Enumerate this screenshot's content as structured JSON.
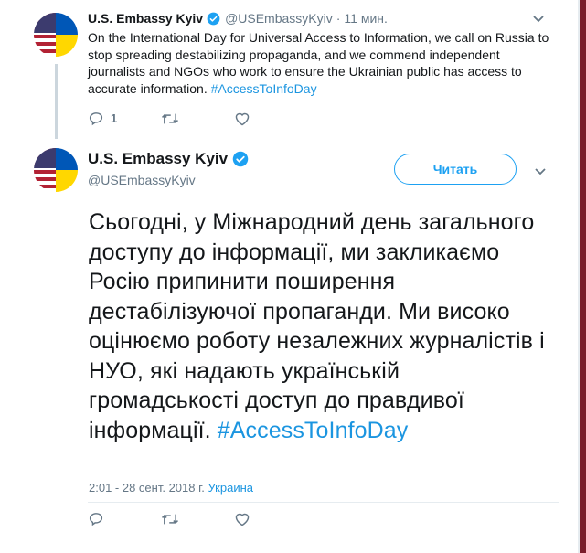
{
  "tweet1": {
    "display_name": "U.S. Embassy Kyiv",
    "handle": "@USEmbassyKyiv",
    "separator": "·",
    "time": "11 мин.",
    "text_main": "On the International Day for Universal Access to Information, we call on Russia to stop spreading destabilizing propaganda, and we commend independent journalists and NGOs who work to ensure the Ukrainian public has access to accurate information. ",
    "hashtag": "#AccessToInfoDay",
    "reply_count": "1"
  },
  "tweet2": {
    "display_name": "U.S. Embassy Kyiv",
    "handle": "@USEmbassyKyiv",
    "follow_label": "Читать",
    "text_main": "Сьогодні, у Міжнародний день загального доступу до інформації, ми закликаємо Росію припинити поширення дестабілізуючої пропаганди. Ми високо оцінюємо роботу незалежних журналістів і НУО, які надають українській громадськості доступ до правдивої інформації. ",
    "hashtag": "#AccessToInfoDay",
    "timestamp": "2:01 - 28 сент. 2018 г.",
    "location": "Украина"
  },
  "icons": {
    "reply": "reply-icon",
    "retweet": "retweet-icon",
    "like": "like-icon",
    "verified": "verified-badge-icon",
    "more": "chevron-down-icon"
  },
  "colors": {
    "accent": "#1da1f2",
    "link": "#1b95e0",
    "secondary_text": "#657786",
    "thread_line": "#ccd6dd"
  }
}
